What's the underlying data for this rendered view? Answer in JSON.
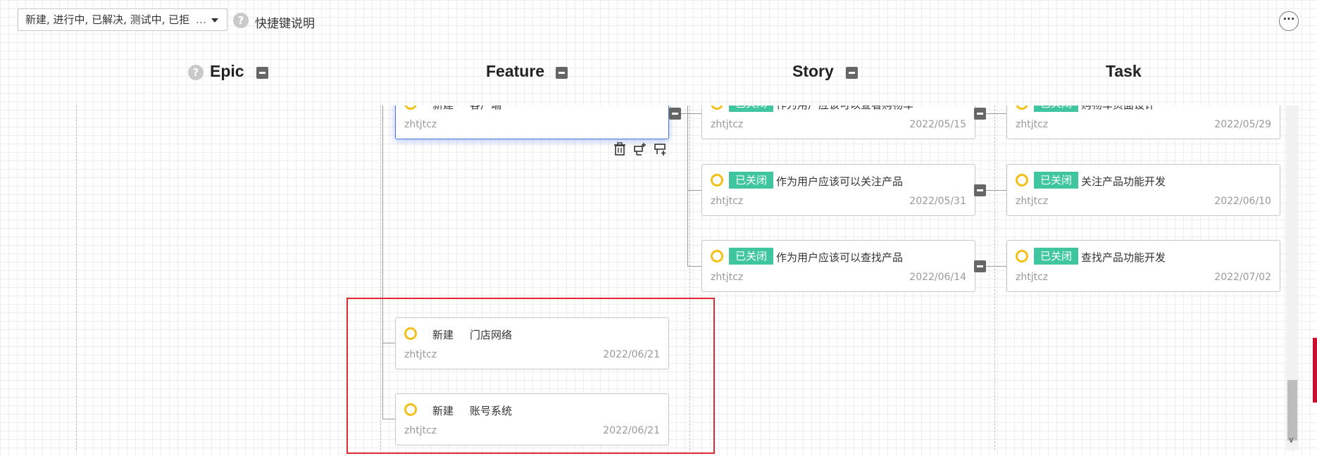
{
  "toolbar": {
    "status_filter_value": "新建, 进行中, 已解决, 测试中, 已拒",
    "status_filter_overflow": "…",
    "help_icon_glyph": "?",
    "shortcut_label": "快捷键说明",
    "more_glyph": "···"
  },
  "columns": [
    {
      "name": "Epic"
    },
    {
      "name": "Feature"
    },
    {
      "name": "Story"
    },
    {
      "name": "Task"
    }
  ],
  "feature_cards": [
    {
      "status": "新建",
      "title": "客户端",
      "user": "zhtjtcz",
      "date": ""
    },
    {
      "status": "新建",
      "title": "门店网络",
      "user": "zhtjtcz",
      "date": "2022/06/21"
    },
    {
      "status": "新建",
      "title": "账号系统",
      "user": "zhtjtcz",
      "date": "2022/06/21"
    }
  ],
  "story_cards": [
    {
      "status": "已关闭",
      "title": "作为用户应该可以查看购物车",
      "user": "zhtjtcz",
      "date": "2022/05/15"
    },
    {
      "status": "已关闭",
      "title": "作为用户应该可以关注产品",
      "user": "zhtjtcz",
      "date": "2022/05/31"
    },
    {
      "status": "已关闭",
      "title": "作为用户应该可以查找产品",
      "user": "zhtjtcz",
      "date": "2022/06/14"
    }
  ],
  "task_cards": [
    {
      "status": "已关闭",
      "title": "购物车页面设计",
      "user": "zhtjtcz",
      "date": "2022/05/29"
    },
    {
      "status": "已关闭",
      "title": "关注产品功能开发",
      "user": "zhtjtcz",
      "date": "2022/06/10"
    },
    {
      "status": "已关闭",
      "title": "查找产品功能开发",
      "user": "zhtjtcz",
      "date": "2022/07/02"
    }
  ],
  "colors": {
    "closed_badge": "#3fc6a0",
    "status_ring": "#f2c018",
    "selection_border": "#4a73e8",
    "highlight_box": "#e0282e"
  },
  "icons": {
    "card_actions": [
      "trash-icon",
      "add-child-icon",
      "add-sibling-icon"
    ]
  }
}
